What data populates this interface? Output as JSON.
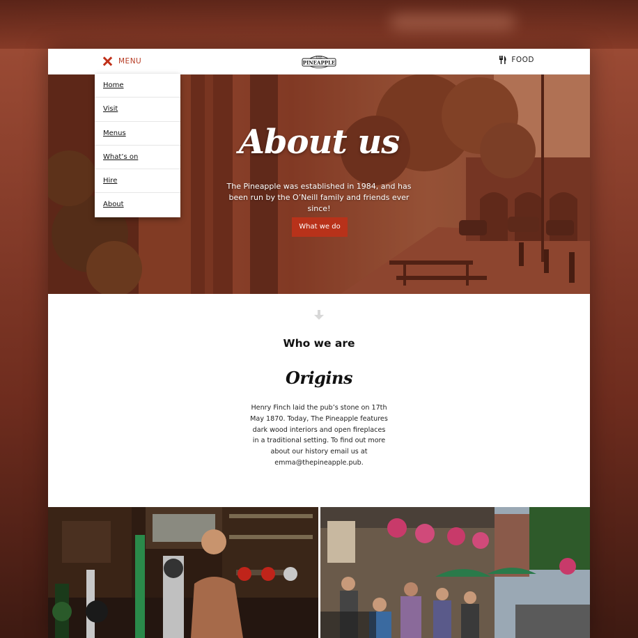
{
  "header": {
    "menu_label": "MENU",
    "food_label": "FOOD",
    "logo_text_top": "THE",
    "logo_text_main": "PINEAPPLE"
  },
  "nav": {
    "items": [
      {
        "label": "Home"
      },
      {
        "label": "Visit"
      },
      {
        "label": "Menus"
      },
      {
        "label": "What’s on"
      },
      {
        "label": "Hire"
      },
      {
        "label": "About"
      }
    ]
  },
  "hero": {
    "title": "About us",
    "text": "The Pineapple was established in 1984, and has been run by the O’Neill family and friends ever since!",
    "button_label": "What we do"
  },
  "who": {
    "title": "Who we are",
    "subtitle": "Origins",
    "text": "Henry Finch laid the pub’s stone on 17th May 1870. Today, The Pineapple features dark wood interiors and open fireplaces in a traditional setting. To find out more about our history email us at emma@thepineapple.pub."
  },
  "colors": {
    "accent": "#b8321a",
    "menu_accent": "#b63a22"
  },
  "icons": {
    "menu": "close-x-icon",
    "food": "cutlery-icon",
    "scroll": "arrow-down-icon"
  }
}
